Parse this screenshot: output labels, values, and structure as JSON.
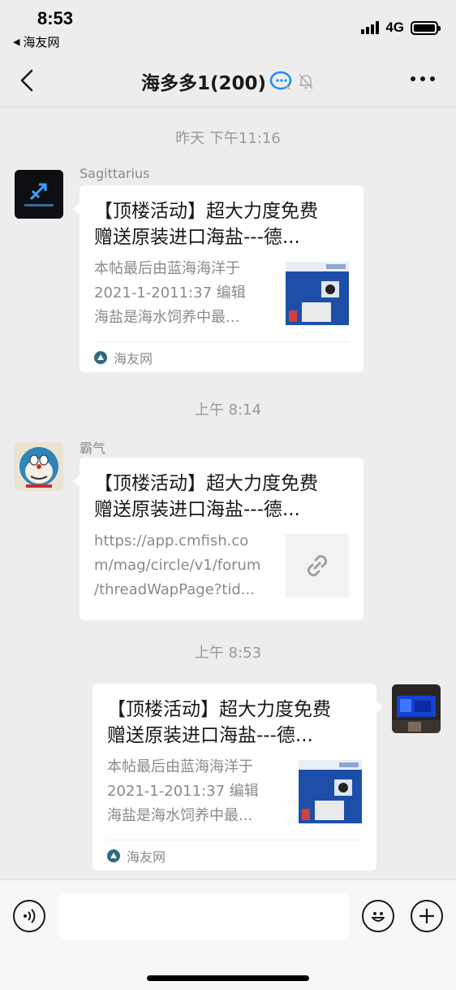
{
  "status_bar": {
    "time": "8:53",
    "back_app": "海友网",
    "network": "4G"
  },
  "nav": {
    "title": "海多多1(200)"
  },
  "messages": [
    {
      "timestamp": "昨天 下午11:16",
      "sender": "Sagittarius",
      "title_line1": "【顶楼活动】超大力度免费",
      "title_line2": "赠送原装进口海盐---德...",
      "desc": [
        "本帖最后由蓝海海洋于",
        "2021-1-2011:37 编辑",
        "海盐是海水饲养中最..."
      ],
      "source": "海友网"
    },
    {
      "timestamp": "上午 8:14",
      "sender": "霸气",
      "title_line1": "【顶楼活动】超大力度免费",
      "title_line2": "赠送原装进口海盐---德...",
      "desc": [
        "https://app.cmfish.co",
        "m/mag/circle/v1/forum",
        "/threadWapPage?tid..."
      ]
    },
    {
      "timestamp": "上午 8:53",
      "title_line1": "【顶楼活动】超大力度免费",
      "title_line2": "赠送原装进口海盐---德...",
      "desc": [
        "本帖最后由蓝海海洋于",
        "2021-1-2011:37 编辑",
        "海盐是海水饲养中最..."
      ],
      "source": "海友网"
    }
  ],
  "icons": {
    "voice": "voice-icon",
    "emoji": "emoji-icon",
    "plus": "plus-icon",
    "link": "link-icon",
    "mute": "mute-bell-icon"
  }
}
